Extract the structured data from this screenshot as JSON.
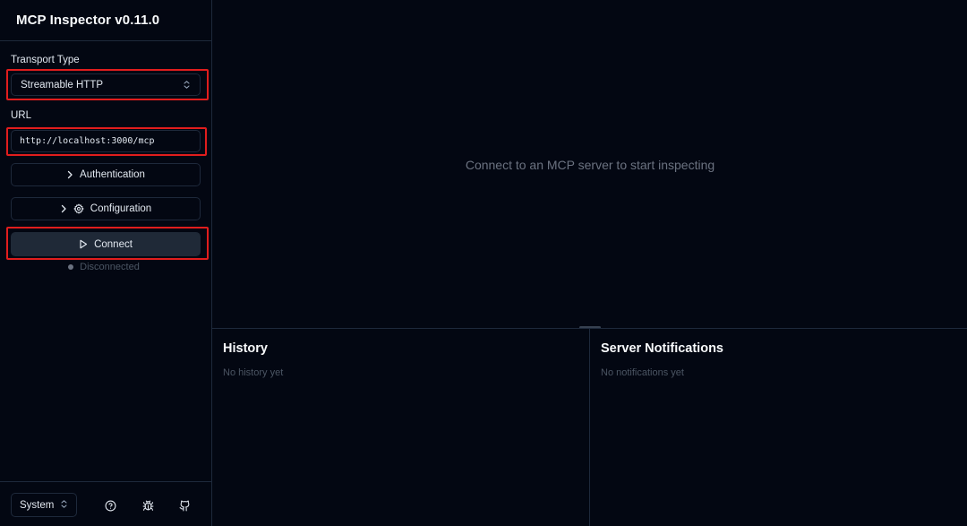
{
  "sidebar": {
    "title": "MCP Inspector v0.11.0",
    "transport_label": "Transport Type",
    "transport_value": "Streamable HTTP",
    "url_label": "URL",
    "url_value": "http://localhost:3000/mcp",
    "auth_label": "Authentication",
    "config_label": "Configuration",
    "connect_label": "Connect",
    "status_text": "Disconnected",
    "theme_value": "System",
    "footer_icons": [
      "help-icon",
      "bug-icon",
      "github-icon"
    ]
  },
  "main": {
    "placeholder": "Connect to an MCP server to start inspecting",
    "history": {
      "title": "History",
      "empty": "No history yet"
    },
    "notifications": {
      "title": "Server Notifications",
      "empty": "No notifications yet"
    }
  },
  "colors": {
    "background": "#030712",
    "border": "#1e293b",
    "highlight": "#e11d1d",
    "connect_bg": "#1f2937",
    "status_dot": "#6b7280"
  }
}
